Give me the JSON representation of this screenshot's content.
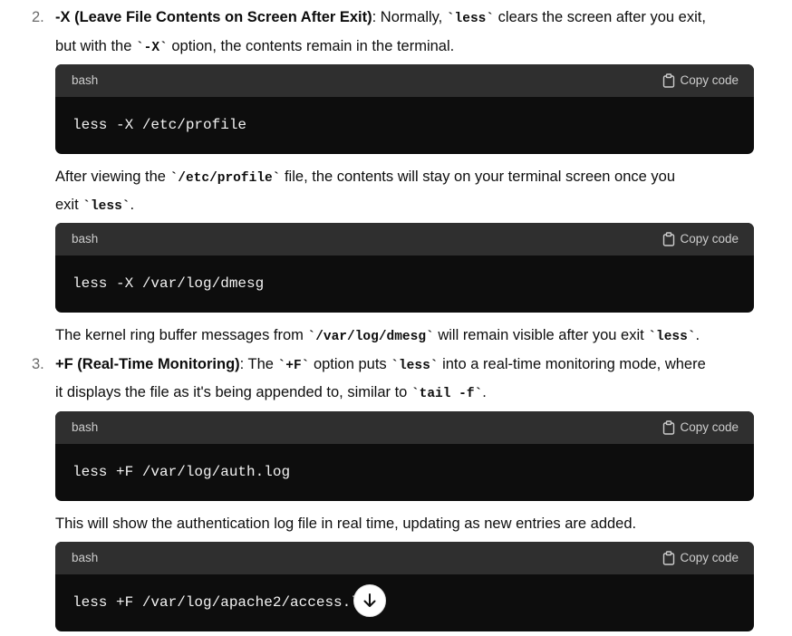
{
  "item2": {
    "number": "2.",
    "title": "-X (Leave File Contents on Screen After Exit)",
    "text_a": ": Normally, ",
    "code_a": "`less`",
    "text_b": " clears the screen after you exit,",
    "text_c": "but with the ",
    "code_b": "`-X`",
    "text_d": " option, the contents remain in the terminal."
  },
  "block1": {
    "lang": "bash",
    "copy_label": "Copy code",
    "code": "less -X /etc/profile"
  },
  "para1": {
    "text_a": "After viewing the ",
    "code_a": "`/etc/profile`",
    "text_b": " file, the contents will stay on your terminal screen once you",
    "text_c": "exit ",
    "code_b": "`less`",
    "text_d": "."
  },
  "block2": {
    "lang": "bash",
    "copy_label": "Copy code",
    "code": "less -X /var/log/dmesg"
  },
  "para2": {
    "text_a": "The kernel ring buffer messages from ",
    "code_a": "`/var/log/dmesg`",
    "text_b": " will remain visible after you exit ",
    "code_b": "`less`",
    "text_c": "."
  },
  "item3": {
    "number": "3.",
    "title": "+F (Real-Time Monitoring)",
    "text_a": ": The ",
    "code_a": "`+F`",
    "text_b": " option puts ",
    "code_b": "`less`",
    "text_c": " into a real-time monitoring mode, where",
    "text_d": "it displays the file as it's being appended to, similar to ",
    "code_c": "`tail -f`",
    "text_e": "."
  },
  "block3": {
    "lang": "bash",
    "copy_label": "Copy code",
    "code": "less +F /var/log/auth.log"
  },
  "para3": {
    "text": "This will show the authentication log file in real time, updating as new entries are added."
  },
  "block4": {
    "lang": "bash",
    "copy_label": "Copy code",
    "code": "less +F /var/log/apache2/access.l"
  },
  "icons": {
    "copy": "clipboard-icon",
    "scroll": "arrow-down-icon"
  }
}
